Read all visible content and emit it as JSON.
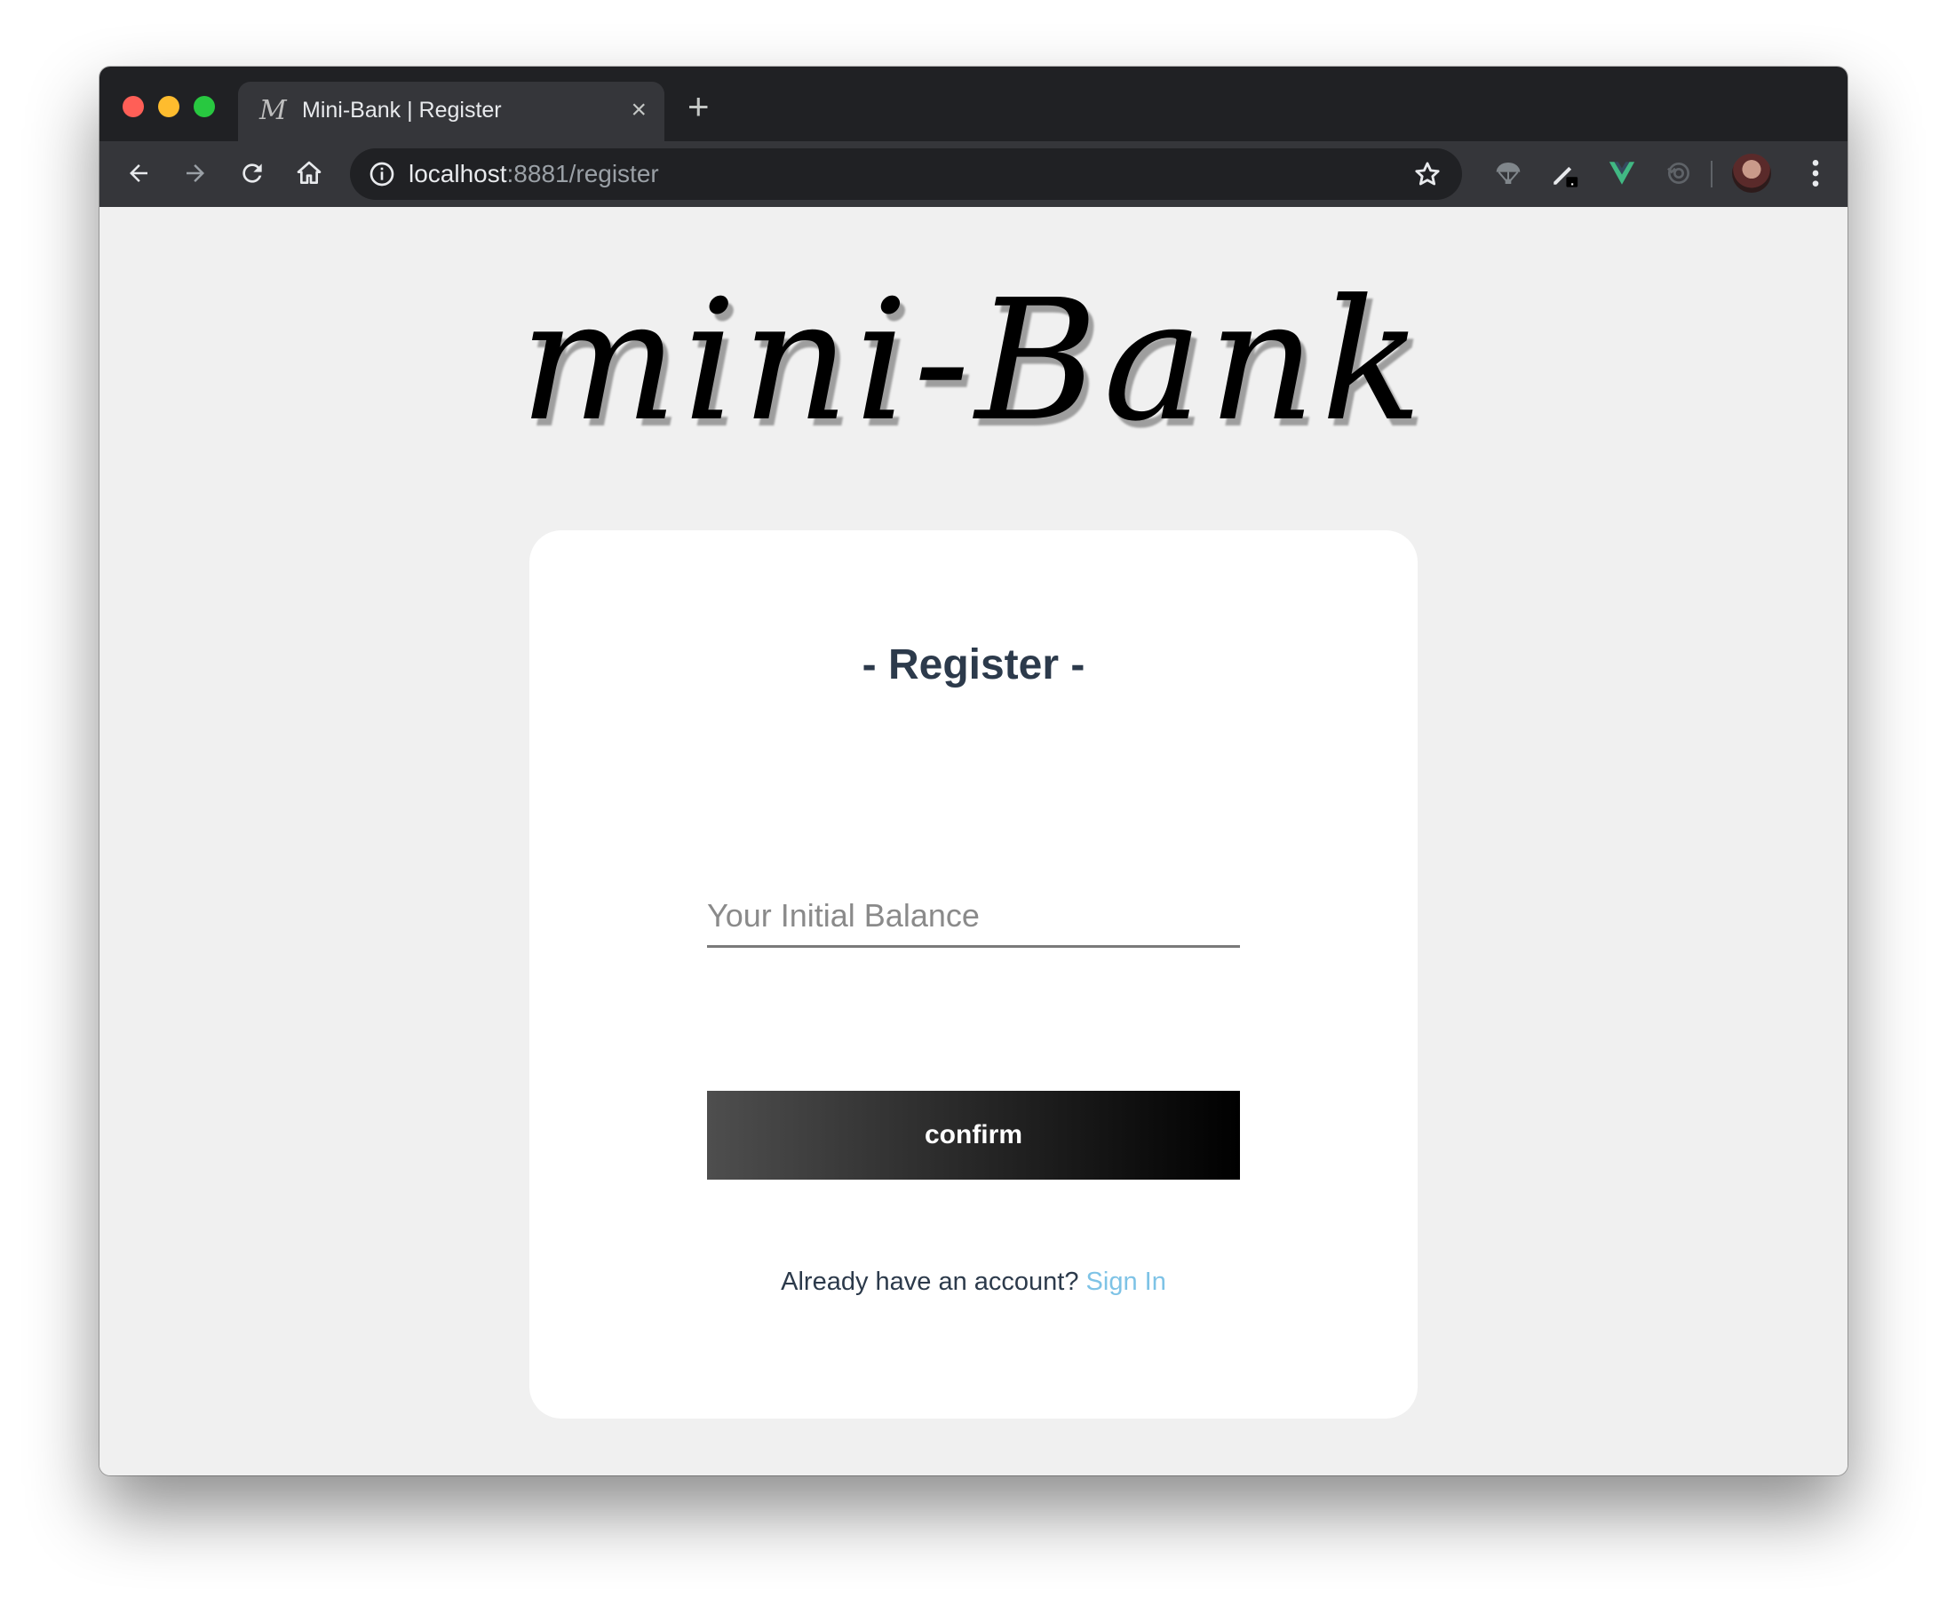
{
  "browser": {
    "tab": {
      "favicon_glyph": "M",
      "title": "Mini-Bank | Register"
    },
    "new_tab_glyph": "+",
    "close_glyph": "×",
    "url_host": "localhost",
    "url_rest": ":8881/register"
  },
  "page": {
    "logo_text": "mini-Bank",
    "card": {
      "title": "- Register -",
      "balance_placeholder": "Your Initial Balance",
      "confirm_label": "confirm",
      "signin_prompt": "Already have an account?",
      "signin_link": "Sign In"
    }
  },
  "colors": {
    "background": "#f0f0f0",
    "card": "#ffffff",
    "heading": "#2c3a4b",
    "link": "#7ec3e6",
    "button_gradient_start": "#4e4e4e",
    "button_gradient_end": "#000000"
  },
  "icons": [
    "back-arrow-icon",
    "forward-arrow-icon",
    "reload-icon",
    "home-icon",
    "info-icon",
    "star-icon",
    "parachute-extension-icon",
    "pen-extension-icon",
    "vue-devtools-icon",
    "sync-extension-icon",
    "menu-dots-icon"
  ]
}
